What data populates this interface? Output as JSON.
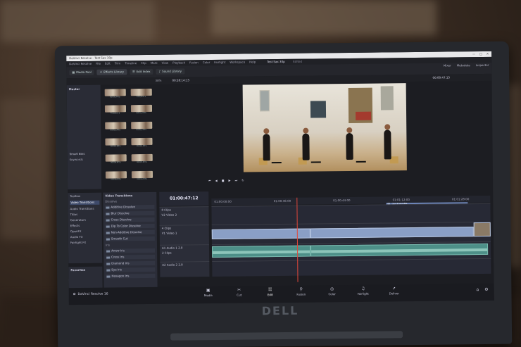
{
  "screen": {
    "titlebar": {
      "app": "DaVinci Resolve - Test Sax 30p"
    },
    "menu": [
      "DaVinci Resolve",
      "File",
      "Edit",
      "Trim",
      "Timeline",
      "Clip",
      "Mark",
      "View",
      "Playback",
      "Fusion",
      "Color",
      "Fairlight",
      "Workspace",
      "Help"
    ],
    "project_title": "Test Sax 30p",
    "project_status": "Edited",
    "top_right": [
      "Mixer",
      "Metadata",
      "Inspector"
    ],
    "toolbar": {
      "media_pool": "Media Pool",
      "effects_library": "Effects Library",
      "edit_index": "Edit Index",
      "sound_library": "Sound Library"
    },
    "subbar": {
      "zoom": "38%",
      "timecode": "00:28:14:13",
      "viewer_timecode": "00:00:47:13"
    },
    "left_panel": {
      "master": "Master",
      "smart_bins": "Smart Bins",
      "keywords": "Keywords"
    },
    "thumbnails": [
      "00000.MTS",
      "Timeline 1",
      "Timeline 2",
      "00001.MTS",
      "00002.MTS",
      "00003.MTS",
      "00004.MTS",
      "00005.MTS",
      "00006.MTS",
      "00007.MTS",
      "00008.MTS",
      "00009.MTS"
    ],
    "fx_nav": {
      "toolbox": "Toolbox",
      "items": [
        "Video Transitions",
        "Audio Transitions",
        "Titles",
        "Generators",
        "Effects",
        "OpenFX",
        "Audio FX",
        "Fairlight FX"
      ],
      "favorites": "Favorites"
    },
    "fx_list": {
      "header": "Video Transitions",
      "cat1": "Dissolve",
      "dissolves": [
        "Additive Dissolve",
        "Blur Dissolve",
        "Cross Dissolve",
        "Dip To Color Dissolve",
        "Non-Additive Dissolve",
        "Smooth Cut"
      ],
      "cat2": "Iris",
      "iris": [
        "Arrow Iris",
        "Cross Iris",
        "Diamond Iris",
        "Eye Iris",
        "Hexagon Iris"
      ]
    },
    "timeline": {
      "timecode": "01:00:47:12",
      "ruler": [
        "01:00:00:00",
        "01:00:36:00",
        "01:00:44:00",
        "01:01:12:00",
        "01:01:28:00"
      ],
      "tracks": [
        {
          "id": "V2",
          "name": "Video 2",
          "clips": "0 Clips"
        },
        {
          "id": "V1",
          "name": "Video 1",
          "clips": "4 Clips"
        },
        {
          "id": "A1",
          "name": "Audio 1",
          "clips": "2 Clips",
          "level": "2.0"
        },
        {
          "id": "A2",
          "name": "Audio 2",
          "clips": "",
          "level": "2.0"
        }
      ],
      "top_clip": "00 - Sax Ensemble"
    },
    "pages": [
      "Media",
      "Cut",
      "Edit",
      "Fusion",
      "Color",
      "Fairlight",
      "Deliver"
    ],
    "active_page": "Edit",
    "brand": "DaVinci Resolve 16"
  },
  "laptop": {
    "logo": "DELL"
  }
}
